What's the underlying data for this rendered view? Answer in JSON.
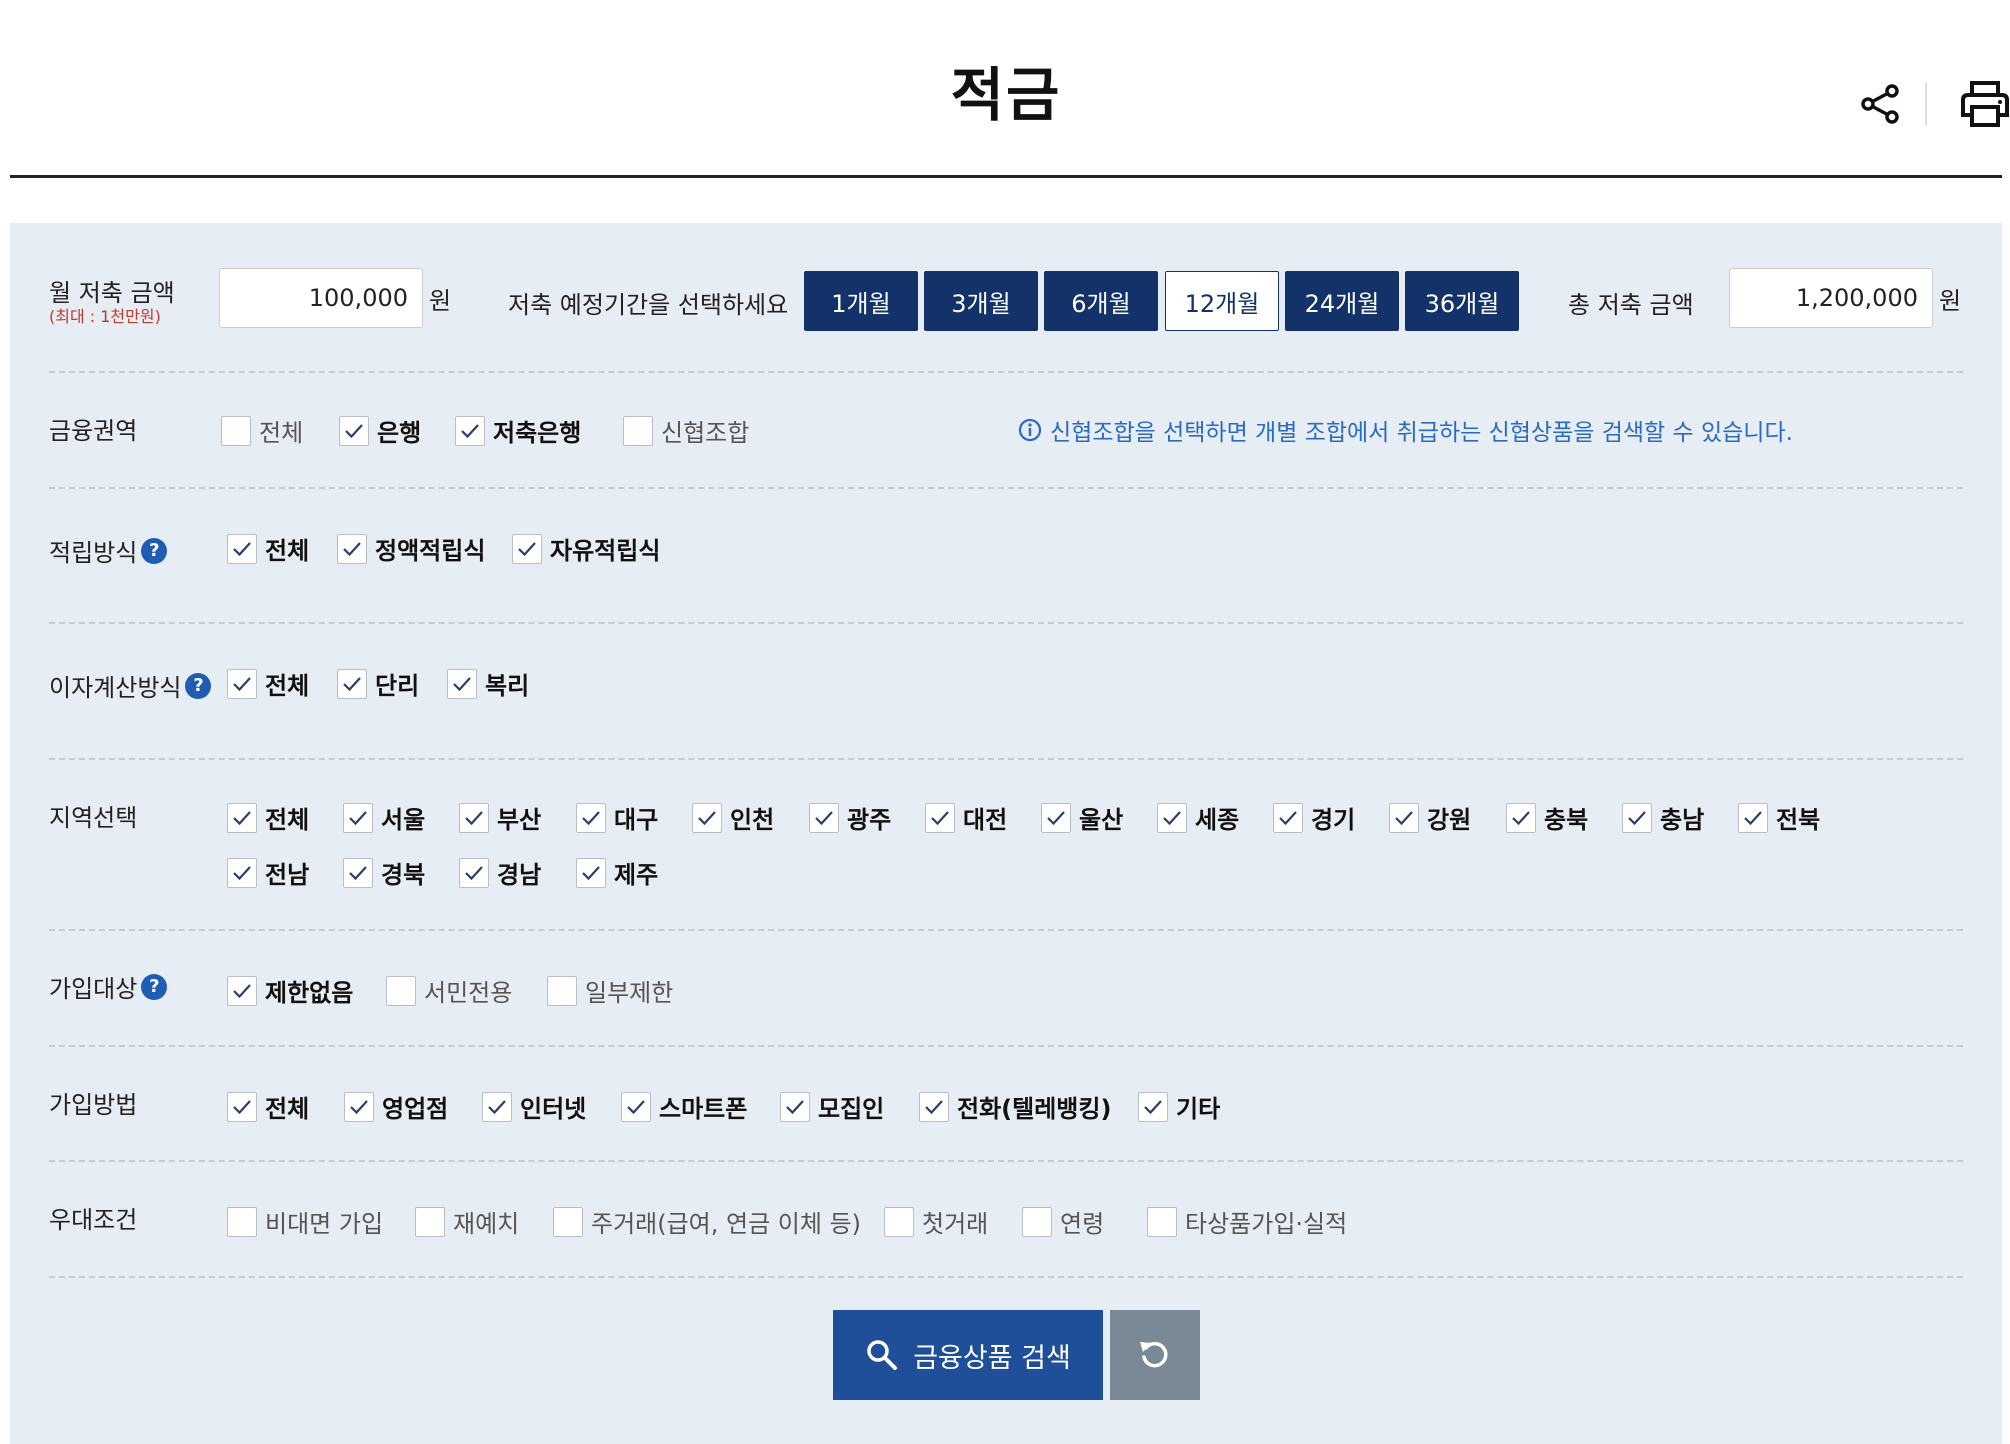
{
  "header": {
    "title": "적금",
    "share_icon": "share-icon",
    "print_icon": "print-icon"
  },
  "amount": {
    "monthly_label": "월 저축 금액",
    "monthly_sub": "(최대 : 1천만원)",
    "monthly_value": "100,000",
    "unit": "원",
    "period_label": "저축 예정기간을 선택하세요",
    "periods": [
      {
        "label": "1개월",
        "active": false
      },
      {
        "label": "3개월",
        "active": false
      },
      {
        "label": "6개월",
        "active": false
      },
      {
        "label": "12개월",
        "active": true
      },
      {
        "label": "24개월",
        "active": false
      },
      {
        "label": "36개월",
        "active": false
      }
    ],
    "total_label": "총 저축 금액",
    "total_value": "1,200,000"
  },
  "filters": {
    "finance_sector": {
      "label": "금융권역",
      "options": [
        {
          "label": "전체",
          "checked": false
        },
        {
          "label": "은행",
          "checked": true
        },
        {
          "label": "저축은행",
          "checked": true
        },
        {
          "label": "신협조합",
          "checked": false
        }
      ],
      "note": "신협조합을 선택하면 개별 조합에서 취급하는 신협상품을 검색할 수 있습니다."
    },
    "saving_method": {
      "label": "적립방식",
      "options": [
        {
          "label": "전체",
          "checked": true
        },
        {
          "label": "정액적립식",
          "checked": true
        },
        {
          "label": "자유적립식",
          "checked": true
        }
      ]
    },
    "interest_method": {
      "label": "이자계산방식",
      "options": [
        {
          "label": "전체",
          "checked": true
        },
        {
          "label": "단리",
          "checked": true
        },
        {
          "label": "복리",
          "checked": true
        }
      ]
    },
    "region": {
      "label": "지역선택",
      "options": [
        {
          "label": "전체",
          "checked": true
        },
        {
          "label": "서울",
          "checked": true
        },
        {
          "label": "부산",
          "checked": true
        },
        {
          "label": "대구",
          "checked": true
        },
        {
          "label": "인천",
          "checked": true
        },
        {
          "label": "광주",
          "checked": true
        },
        {
          "label": "대전",
          "checked": true
        },
        {
          "label": "울산",
          "checked": true
        },
        {
          "label": "세종",
          "checked": true
        },
        {
          "label": "경기",
          "checked": true
        },
        {
          "label": "강원",
          "checked": true
        },
        {
          "label": "충북",
          "checked": true
        },
        {
          "label": "충남",
          "checked": true
        },
        {
          "label": "전북",
          "checked": true
        },
        {
          "label": "전남",
          "checked": true
        },
        {
          "label": "경북",
          "checked": true
        },
        {
          "label": "경남",
          "checked": true
        },
        {
          "label": "제주",
          "checked": true
        }
      ]
    },
    "eligibility": {
      "label": "가입대상",
      "options": [
        {
          "label": "제한없음",
          "checked": true
        },
        {
          "label": "서민전용",
          "checked": false
        },
        {
          "label": "일부제한",
          "checked": false
        }
      ]
    },
    "join_method": {
      "label": "가입방법",
      "options": [
        {
          "label": "전체",
          "checked": true
        },
        {
          "label": "영업점",
          "checked": true
        },
        {
          "label": "인터넷",
          "checked": true
        },
        {
          "label": "스마트폰",
          "checked": true
        },
        {
          "label": "모집인",
          "checked": true
        },
        {
          "label": "전화(텔레뱅킹)",
          "checked": true
        },
        {
          "label": "기타",
          "checked": true
        }
      ]
    },
    "preferential": {
      "label": "우대조건",
      "options": [
        {
          "label": "비대면 가입",
          "checked": false
        },
        {
          "label": "재예치",
          "checked": false
        },
        {
          "label": "주거래(급여, 연금 이체 등)",
          "checked": false
        },
        {
          "label": "첫거래",
          "checked": false
        },
        {
          "label": "연령",
          "checked": false
        },
        {
          "label": "타상품가입·실적",
          "checked": false
        }
      ]
    }
  },
  "actions": {
    "search_label": "금융상품 검색",
    "search_icon": "search-icon",
    "reset_icon": "refresh-icon"
  },
  "colors": {
    "navy": "#14326a",
    "search_button": "#1f4f98",
    "reset_button": "#7b8896",
    "panel_bg": "#e7edf5",
    "info_blue": "#2a6bc0",
    "limit_red": "#c0392b"
  }
}
